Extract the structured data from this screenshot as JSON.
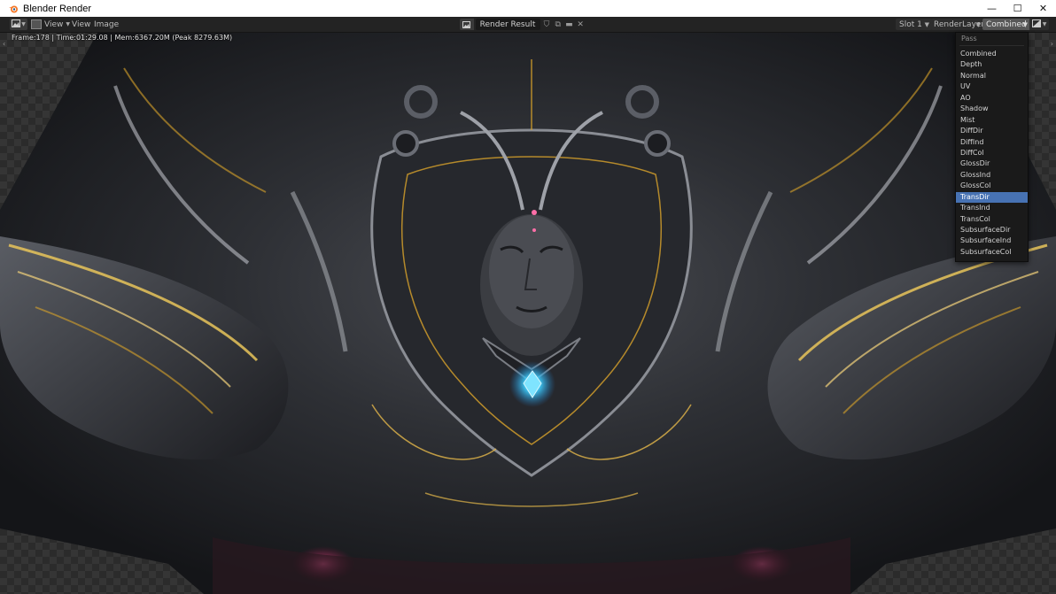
{
  "window": {
    "title": "Blender Render",
    "minimize": "—",
    "maximize": "☐",
    "close": "✕"
  },
  "header": {
    "menus": [
      "View",
      "View",
      "Image"
    ],
    "image_name": "Render Result",
    "slot": "Slot 1",
    "render_layer": "RenderLayer",
    "pass": "Combined"
  },
  "viewport": {
    "info": "Frame:178 | Time:01:29.08 | Mem:6367.20M (Peak 8279.63M)"
  },
  "pass_menu": {
    "title": "Pass",
    "items": [
      "Combined",
      "Depth",
      "Normal",
      "UV",
      "AO",
      "Shadow",
      "Mist",
      "DiffDir",
      "DiffInd",
      "DiffCol",
      "GlossDir",
      "GlossInd",
      "GlossCol",
      "TransDir",
      "TransInd",
      "TransCol",
      "SubsurfaceDir",
      "SubsurfaceInd",
      "SubsurfaceCol"
    ],
    "active_index": 13
  },
  "colors": {
    "accent": "#4772b3",
    "header_bg": "#232323",
    "gold": "#d9a32a",
    "gem": "#3fd0ff"
  }
}
